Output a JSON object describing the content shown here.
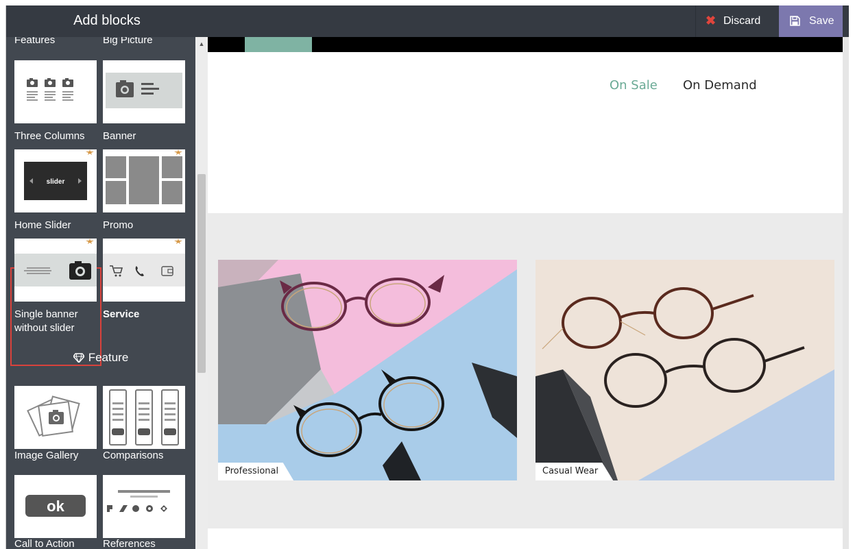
{
  "sidebar": {
    "title": "Add blocks",
    "partial_labels": [
      "Features",
      "Big Picture"
    ],
    "blocks": [
      {
        "label": "Three Columns"
      },
      {
        "label": "Banner"
      },
      {
        "label": "Home Slider",
        "thumb_text": "slider"
      },
      {
        "label": "Promo"
      },
      {
        "label": "Single banner without slider",
        "selected": true
      },
      {
        "label": "Service"
      }
    ],
    "category": {
      "label": "Feature",
      "icon": "gem-icon"
    },
    "feature_blocks": [
      {
        "label": "Image Gallery"
      },
      {
        "label": "Comparisons"
      },
      {
        "label": "Call to Action",
        "thumb_text": "ok"
      },
      {
        "label": "References"
      }
    ]
  },
  "toolbar": {
    "discard_label": "Discard",
    "save_label": "Save"
  },
  "page": {
    "nav": {
      "on_sale": "On Sale",
      "on_demand": "On Demand"
    },
    "banners": [
      {
        "caption": "Professional"
      },
      {
        "caption": "Casual Wear"
      }
    ]
  },
  "colors": {
    "sidebar_bg": "#424850",
    "topbar_bg": "#353a42",
    "save_bg": "#7c78ae",
    "accent_green": "#7fb3a3",
    "selection_border": "#d9423c"
  }
}
